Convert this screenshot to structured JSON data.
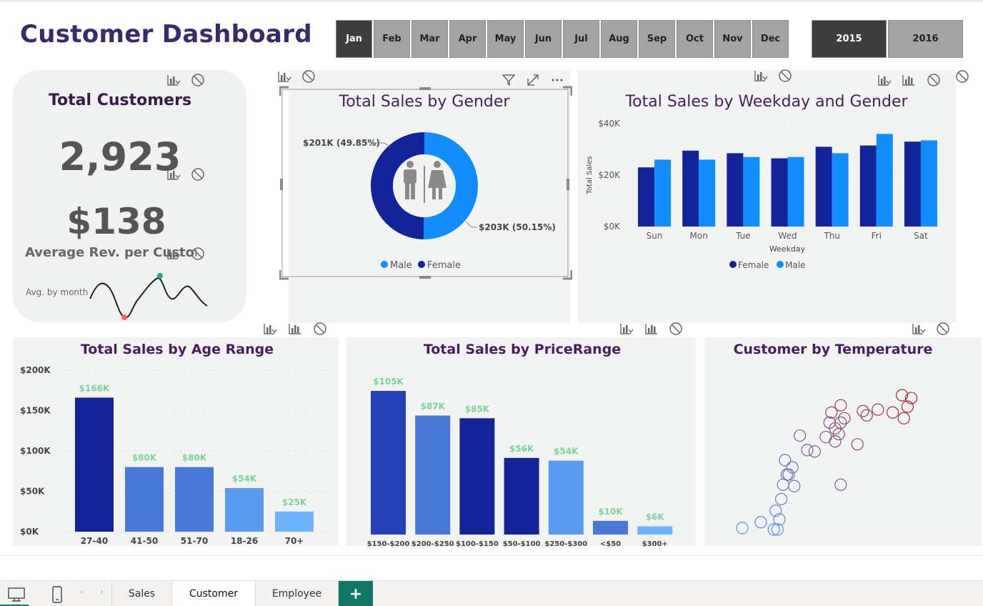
{
  "dashboard": {
    "title": "Customer Dashboard"
  },
  "months": [
    "Jan",
    "Feb",
    "Mar",
    "Apr",
    "May",
    "Jun",
    "Jul",
    "Aug",
    "Sep",
    "Oct",
    "Nov",
    "Dec"
  ],
  "active_month": "Jan",
  "years": [
    "2015",
    "2016"
  ],
  "active_year": "2015",
  "kpi": {
    "title": "Total Customers",
    "customers": "2,923",
    "avg_revenue": "$138",
    "avg_revenue_label": "Average Rev. per Customer",
    "sparkline_label": "Avg. by month"
  },
  "gender_panel": {
    "title": "Total Sales by Gender"
  },
  "weekday_panel": {
    "title": "Total Sales by Weekday and Gender"
  },
  "age_panel": {
    "title": "Total Sales by Age Range"
  },
  "price_panel": {
    "title": "Total Sales by PriceRange"
  },
  "temp_panel": {
    "title": "Customer by Temperature"
  },
  "colors": {
    "title": "#3a2a6b",
    "female_dark": "#13239a",
    "male_light": "#118dff",
    "panel_title": "#4a1d5e",
    "data_label": "#7fd39a"
  },
  "icons": [
    "visual-options-icon",
    "no-interaction-icon",
    "filter-icon",
    "focus-mode-icon",
    "more-options-icon",
    "desktop-icon",
    "mobile-icon"
  ],
  "tabs": {
    "sales": "Sales",
    "customer": "Customer",
    "employee": "Employee",
    "add": "+"
  },
  "active_tab": "Customer",
  "chart_data": [
    {
      "type": "pie",
      "title": "Total Sales by Gender",
      "slices": [
        {
          "name": "Male",
          "value": 203,
          "percent": 50.15,
          "label": "$203K (50.15%)"
        },
        {
          "name": "Female",
          "value": 201,
          "percent": 49.85,
          "label": "$201K (49.85%)"
        }
      ],
      "legend": [
        "Male",
        "Female"
      ]
    },
    {
      "type": "bar",
      "title": "Total Sales by Weekday and Gender",
      "xlabel": "Weekday",
      "ylabel": "Total Sales",
      "categories": [
        "Sun",
        "Mon",
        "Tue",
        "Wed",
        "Thu",
        "Fri",
        "Sat"
      ],
      "series": [
        {
          "name": "Female",
          "values": [
            23000,
            29500,
            28500,
            26500,
            31000,
            31500,
            33000
          ]
        },
        {
          "name": "Male",
          "values": [
            26000,
            26000,
            27000,
            27000,
            28500,
            36000,
            33500
          ]
        }
      ],
      "yticks": [
        "$0K",
        "$20K",
        "$40K"
      ],
      "ylim": [
        0,
        40000
      ],
      "legend": [
        "Female",
        "Male"
      ]
    },
    {
      "type": "bar",
      "title": "Total Sales by Age Range",
      "categories": [
        "27-40",
        "41-50",
        "51-70",
        "18-26",
        "70+"
      ],
      "values": [
        166,
        80,
        80,
        54,
        25
      ],
      "labels": [
        "$166K",
        "$80K",
        "$80K",
        "$54K",
        "$25K"
      ],
      "yticks": [
        "$0K",
        "$50K",
        "$100K",
        "$150K",
        "$200K"
      ],
      "ylim": [
        0,
        200
      ]
    },
    {
      "type": "bar",
      "title": "Total Sales by PriceRange",
      "categories": [
        "$150-$200",
        "$200-$250",
        "$100-$150",
        "$50-$100",
        "$250-$300",
        "<$50",
        "$300+"
      ],
      "values": [
        105,
        87,
        85,
        56,
        54,
        10,
        6
      ],
      "labels": [
        "$105K",
        "$87K",
        "$85K",
        "$56K",
        "$54K",
        "$10K",
        "$6K"
      ],
      "ylim": [
        0,
        110
      ]
    },
    {
      "type": "scatter",
      "title": "Customer by Temperature",
      "points": [
        [
          0.05,
          0.08
        ],
        [
          0.15,
          0.12
        ],
        [
          0.23,
          0.2
        ],
        [
          0.26,
          0.28
        ],
        [
          0.27,
          0.38
        ],
        [
          0.3,
          0.45
        ],
        [
          0.32,
          0.5
        ],
        [
          0.29,
          0.45
        ],
        [
          0.28,
          0.55
        ],
        [
          0.22,
          0.07
        ],
        [
          0.24,
          0.07
        ],
        [
          0.25,
          0.14
        ],
        [
          0.33,
          0.37
        ],
        [
          0.4,
          0.62
        ],
        [
          0.36,
          0.72
        ],
        [
          0.44,
          0.61
        ],
        [
          0.5,
          0.71
        ],
        [
          0.52,
          0.81
        ],
        [
          0.55,
          0.77
        ],
        [
          0.58,
          0.81
        ],
        [
          0.57,
          0.73
        ],
        [
          0.6,
          0.84
        ],
        [
          0.55,
          0.68
        ],
        [
          0.53,
          0.88
        ],
        [
          0.58,
          0.93
        ],
        [
          0.67,
          0.66
        ],
        [
          0.72,
          0.86
        ],
        [
          0.7,
          0.89
        ],
        [
          0.78,
          0.9
        ],
        [
          0.86,
          0.88
        ],
        [
          0.91,
          1.0
        ],
        [
          0.96,
          0.98
        ],
        [
          0.94,
          0.92
        ],
        [
          0.92,
          0.84
        ],
        [
          0.58,
          0.38
        ]
      ]
    }
  ]
}
